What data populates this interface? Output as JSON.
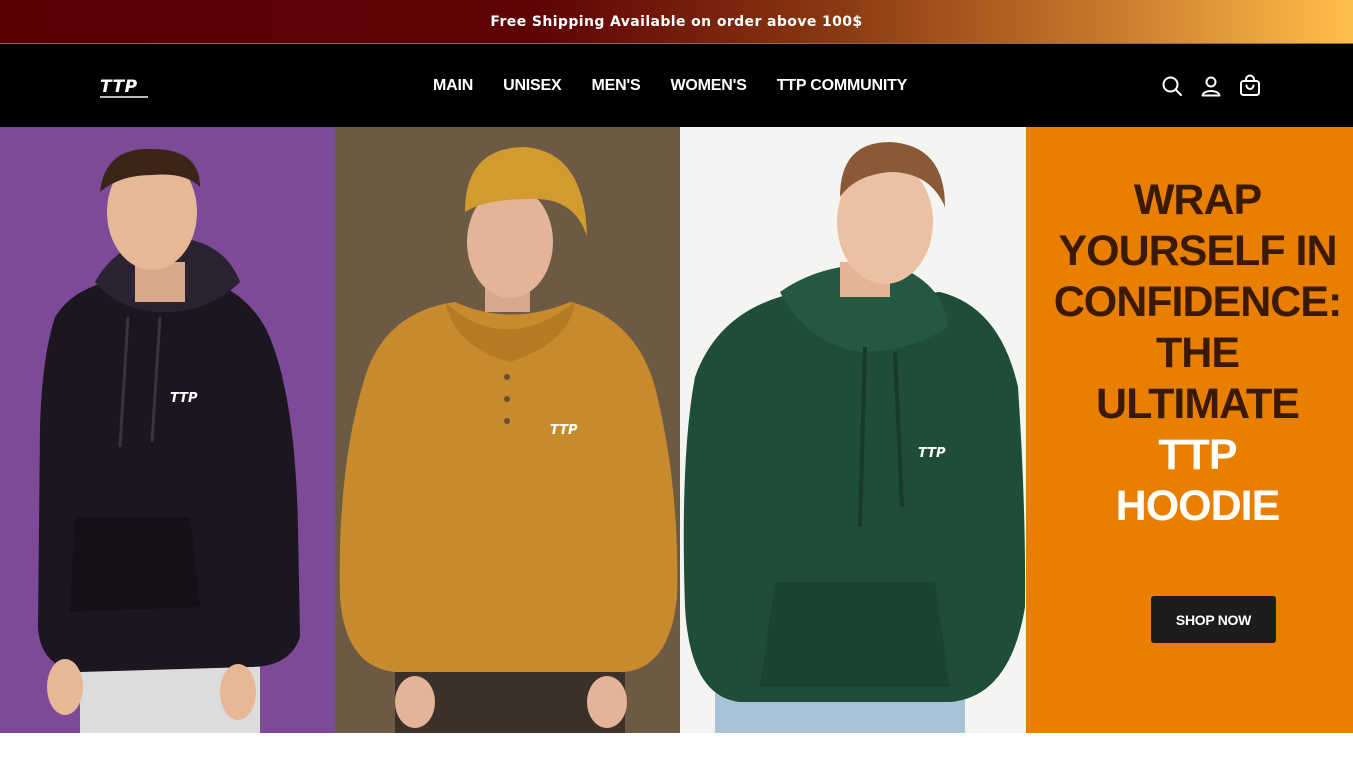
{
  "announcement": {
    "text": "Free Shipping Available on order above 100$"
  },
  "header": {
    "logo_text": "TTP",
    "nav": [
      {
        "label": "MAIN"
      },
      {
        "label": "UNISEX"
      },
      {
        "label": "MEN'S"
      },
      {
        "label": "WOMEN'S"
      },
      {
        "label": "TTP COMMUNITY"
      }
    ],
    "icons": [
      "search-icon",
      "account-icon",
      "cart-icon"
    ]
  },
  "hero": {
    "panels": [
      {
        "background": "#7d4a98",
        "hoodie_color": "#1c1620",
        "print": "TTP"
      },
      {
        "background": "#6c5a45",
        "hoodie_color": "#c78a2c",
        "print": "TTP"
      },
      {
        "background": "#f4f4f2",
        "hoodie_color": "#1f4d38",
        "print": "TTP"
      }
    ],
    "headline_lines": [
      "WRAP",
      "YOURSELF IN",
      "CONFIDENCE:",
      "THE",
      "ULTIMATE"
    ],
    "headline_highlight": [
      "TTP",
      "HOODIE"
    ],
    "cta_label": "SHOP NOW",
    "accent_color": "#e97f00"
  }
}
